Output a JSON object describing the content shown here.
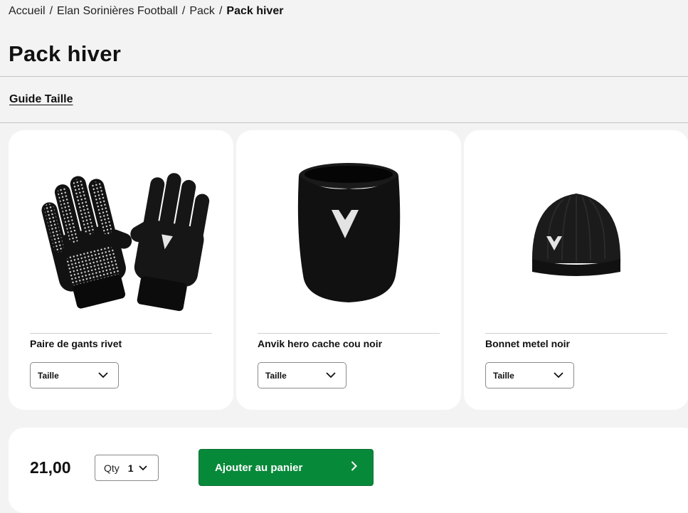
{
  "breadcrumb": {
    "items": [
      "Accueil",
      "Elan Sorinières Football",
      "Pack"
    ],
    "separator": "/",
    "current": "Pack hiver"
  },
  "page": {
    "title": "Pack hiver"
  },
  "guide_link": "Guide Taille",
  "products": [
    {
      "name": "Paire de gants rivet",
      "size_label": "Taille",
      "icon": "gloves-image"
    },
    {
      "name": "Anvik hero cache cou noir",
      "size_label": "Taille",
      "icon": "neck-warmer-image"
    },
    {
      "name": "Bonnet metel noir",
      "size_label": "Taille",
      "icon": "beanie-image"
    }
  ],
  "purchase": {
    "price": "21,00",
    "qty_label": "Qty",
    "qty_value": "1",
    "add_to_cart_label": "Ajouter au panier"
  },
  "colors": {
    "page_bg": "#f3f3f3",
    "card_bg": "#ffffff",
    "accent_green": "#07893a"
  }
}
